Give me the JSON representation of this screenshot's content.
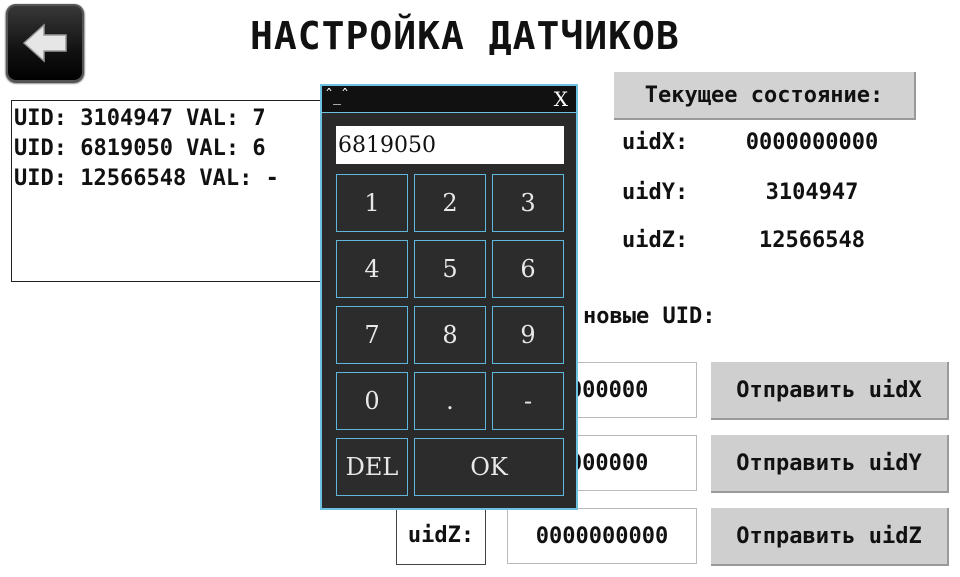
{
  "header": {
    "title": "НАСТРОЙКА ДАТЧИКОВ",
    "back_icon": "arrow-left-icon"
  },
  "uid_list": [
    "UID: 3104947 VAL: 7",
    "UID: 6819050 VAL: 6",
    "UID: 12566548 VAL: -"
  ],
  "current_state": {
    "header": "Текущее состояние:",
    "rows": [
      {
        "label": "uidX:",
        "value": "0000000000"
      },
      {
        "label": "uidY:",
        "value": "3104947"
      },
      {
        "label": "uidZ:",
        "value": "12566548"
      }
    ]
  },
  "new_uid": {
    "label": "новые UID:",
    "rows": [
      {
        "label": "",
        "value": "0000000",
        "button": "Отправить uidX"
      },
      {
        "label": "",
        "value": "0000000",
        "button": "Отправить uidY"
      },
      {
        "label": "uidZ:",
        "value": "0000000000",
        "button": "Отправить uidZ"
      }
    ]
  },
  "keypad": {
    "minimize": "ˆ_ˆ",
    "close": "X",
    "display": "6819050",
    "keys": [
      "1",
      "2",
      "3",
      "4",
      "5",
      "6",
      "7",
      "8",
      "9",
      "0",
      ".",
      "-",
      "DEL",
      "OK"
    ]
  }
}
